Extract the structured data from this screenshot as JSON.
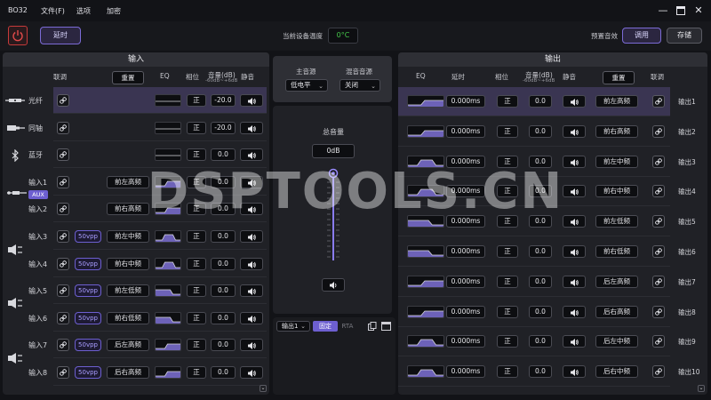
{
  "app": {
    "title": "BO32"
  },
  "menu": [
    "文件(F)",
    "选项",
    "加密"
  ],
  "window_controls": [
    "minimize",
    "maximize",
    "close"
  ],
  "toolbar": {
    "delay_label": "延时",
    "temp_label": "当前设备温度",
    "temp_value": "0°C",
    "preset_label": "预置音效",
    "recall_label": "调用",
    "save_label": "存储"
  },
  "input_panel": {
    "title": "输入",
    "headers": {
      "link": "联调",
      "reset": "重置",
      "eq": "EQ",
      "phase": "相位",
      "volume": "音量(dB)",
      "volume_range": "-60dB~+6dB",
      "mute": "静音"
    },
    "rows": [
      {
        "name": "光纤",
        "icon": "optical-icon",
        "phase": "正",
        "volume": "-20.0",
        "selected": true
      },
      {
        "name": "同轴",
        "icon": "coax-icon",
        "phase": "正",
        "volume": "-20.0"
      },
      {
        "name": "蓝牙",
        "icon": "bluetooth-icon",
        "phase": "正",
        "volume": "0.0"
      },
      {
        "name": "输入1",
        "routing": "前左高频",
        "phase": "正",
        "volume": "0.0"
      },
      {
        "name": "输入2",
        "routing": "前右高频",
        "phase": "正",
        "volume": "0.0"
      },
      {
        "name": "输入3",
        "vpp": "50vpp",
        "routing": "前左中频",
        "phase": "正",
        "volume": "0.0"
      },
      {
        "name": "输入4",
        "vpp": "50vpp",
        "routing": "前右中频",
        "phase": "正",
        "volume": "0.0"
      },
      {
        "name": "输入5",
        "vpp": "50vpp",
        "routing": "前左低频",
        "phase": "正",
        "volume": "0.0"
      },
      {
        "name": "输入6",
        "vpp": "50vpp",
        "routing": "前右低频",
        "phase": "正",
        "volume": "0.0"
      },
      {
        "name": "输入7",
        "vpp": "50vpp",
        "routing": "后左高频",
        "phase": "正",
        "volume": "0.0"
      },
      {
        "name": "输入8",
        "vpp": "50vpp",
        "routing": "后右高频",
        "phase": "正",
        "volume": "0.0"
      }
    ],
    "aux_badge": "AUX"
  },
  "center": {
    "main_source_label": "主音源",
    "main_source_value": "低电平",
    "mix_source_label": "混音音源",
    "mix_source_value": "关闭",
    "master_label": "总音量",
    "master_value": "0dB",
    "master_level_fraction": 1.0,
    "bottom": {
      "output_select": "输出1",
      "tab_fixed": "固定",
      "tab_rta": "RTA"
    }
  },
  "output_panel": {
    "title": "输出",
    "headers": {
      "eq": "EQ",
      "delay": "延时",
      "phase": "相位",
      "volume": "音量(dB)",
      "volume_range": "-60dB~+6dB",
      "mute": "静音",
      "reset": "重置",
      "link": "联调"
    },
    "rows": [
      {
        "name": "输出1",
        "delay": "0.000ms",
        "phase": "正",
        "volume": "0.0",
        "routing": "前左高频",
        "selected": true
      },
      {
        "name": "输出2",
        "delay": "0.000ms",
        "phase": "正",
        "volume": "0.0",
        "routing": "前右高频"
      },
      {
        "name": "输出3",
        "delay": "0.000ms",
        "phase": "正",
        "volume": "0.0",
        "routing": "前左中频"
      },
      {
        "name": "输出4",
        "delay": "0.000ms",
        "phase": "正",
        "volume": "0.0",
        "routing": "前右中频"
      },
      {
        "name": "输出5",
        "delay": "0.000ms",
        "phase": "正",
        "volume": "0.0",
        "routing": "前左低频"
      },
      {
        "name": "输出6",
        "delay": "0.000ms",
        "phase": "正",
        "volume": "0.0",
        "routing": "前右低频"
      },
      {
        "name": "输出7",
        "delay": "0.000ms",
        "phase": "正",
        "volume": "0.0",
        "routing": "后左高频"
      },
      {
        "name": "输出8",
        "delay": "0.000ms",
        "phase": "正",
        "volume": "0.0",
        "routing": "后右高频"
      },
      {
        "name": "输出9",
        "delay": "0.000ms",
        "phase": "正",
        "volume": "0.0",
        "routing": "后左中频"
      },
      {
        "name": "输出10",
        "delay": "0.000ms",
        "phase": "正",
        "volume": "0.0",
        "routing": "后右中频"
      }
    ]
  },
  "watermark": "DSPTOOLS.CN",
  "colors": {
    "accent": "#7c6bd6",
    "temp": "#45c84a",
    "power": "#c63a3a",
    "selected_row": "#3a3552"
  }
}
